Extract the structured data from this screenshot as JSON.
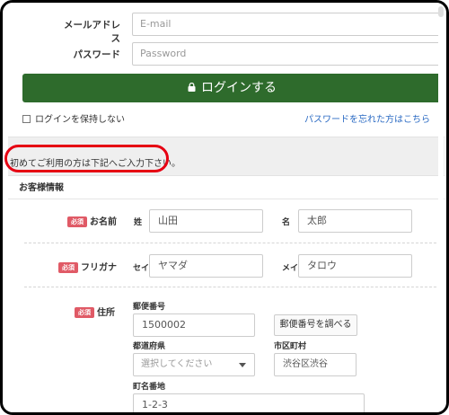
{
  "login": {
    "email_label": "メールアドレス",
    "email_placeholder": "E-mail",
    "password_label": "パスワード",
    "password_placeholder": "Password",
    "login_button": "ログインする",
    "keep_logged_in": "ログインを保持しない",
    "forgot_password": "パスワードを忘れた方はこちら"
  },
  "notice": "初めてご利用の方は下記へご入力下さい。",
  "customer": {
    "section_title": "お客様情報",
    "required_badge": "必須",
    "name": {
      "label": "お名前",
      "last_label": "姓",
      "last_value": "山田",
      "first_label": "名",
      "first_value": "太郎"
    },
    "kana": {
      "label": "フリガナ",
      "last_label": "セイ",
      "last_value": "ヤマダ",
      "first_label": "メイ",
      "first_value": "タロウ"
    },
    "address": {
      "label": "住所",
      "postal_label": "郵便番号",
      "postal_value": "1500002",
      "postal_lookup_button": "郵便番号を調べる",
      "prefecture_label": "都道府県",
      "prefecture_selected": "選択してください",
      "city_label": "市区町村",
      "city_value": "渋谷区渋谷",
      "street_label": "町名番地",
      "street_value": "1-2-3"
    }
  },
  "colors": {
    "login_button": "#2e6b2c",
    "link": "#2a6ac3",
    "required_badge": "#e05a66",
    "highlight_ring": "#e60012"
  }
}
